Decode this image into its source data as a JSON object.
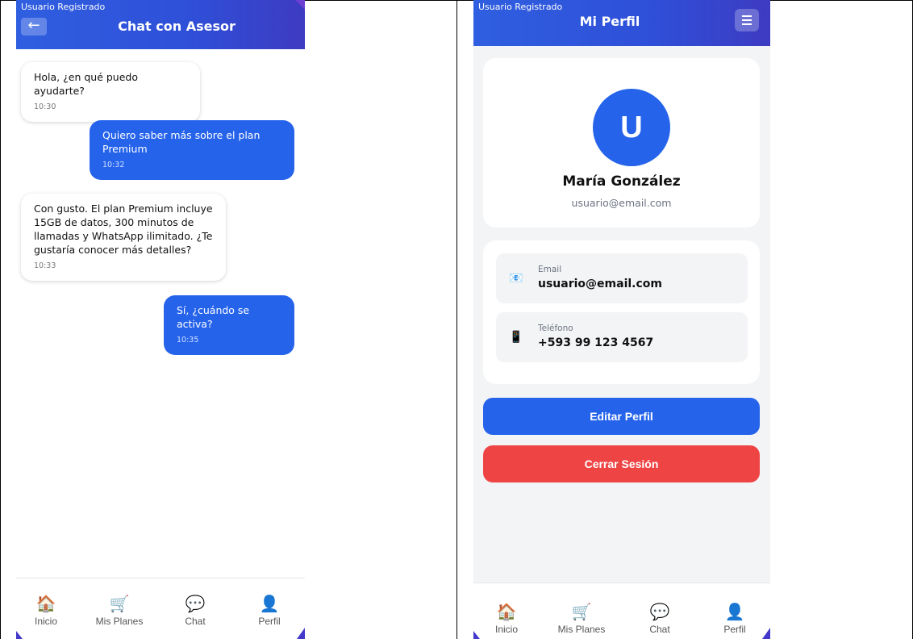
{
  "chat_screen": {
    "user_tag": "Usuario Registrado",
    "back_glyph": "←",
    "title": "Chat con Asesor",
    "messages": [
      {
        "sender": "advisor",
        "text": "Hola, ¿en qué puedo ayudarte?",
        "time": "10:30"
      },
      {
        "sender": "user",
        "text": "Quiero saber más sobre el plan Premium",
        "time": "10:32"
      },
      {
        "sender": "advisor",
        "text": "Con gusto. El plan Premium incluye 15GB de datos, 300 minutos de llamadas y WhatsApp ilimitado. ¿Te gustaría conocer más detalles?",
        "time": "10:33"
      },
      {
        "sender": "user",
        "text": "Sí, ¿cuándo se activa?",
        "time": "10:35"
      }
    ]
  },
  "profile_screen": {
    "user_tag": "Usuario Registrado",
    "title": "Mi Perfil",
    "avatar_initial": "U",
    "name": "María González",
    "email": "usuario@email.com",
    "info": [
      {
        "icon": "email-icon",
        "label": "Email",
        "value": "usuario@email.com"
      },
      {
        "icon": "phone-icon",
        "label": "Teléfono",
        "value": "+593 99 123 4567"
      }
    ],
    "edit_button": "Editar Perfil",
    "logout_button": "Cerrar Sesión"
  },
  "nav": {
    "items": [
      {
        "label": "Inicio",
        "icon": "home-icon"
      },
      {
        "label": "Mis Planes",
        "icon": "cart-icon"
      },
      {
        "label": "Chat",
        "icon": "chat-bubble-icon"
      },
      {
        "label": "Perfil",
        "icon": "user-icon"
      }
    ]
  },
  "colors": {
    "primary": "#2563eb",
    "danger": "#ef4444",
    "header_gradient_end": "#3d3bc2"
  }
}
